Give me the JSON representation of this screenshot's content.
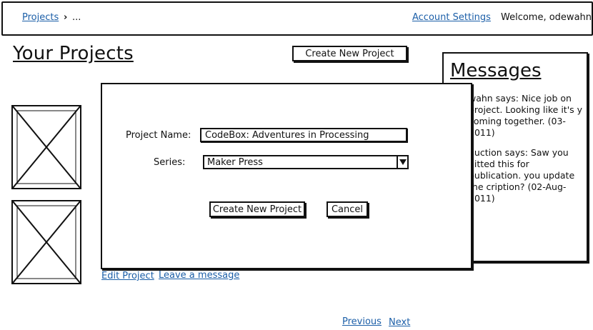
{
  "header": {
    "breadcrumb_root": "Projects",
    "breadcrumb_chevron": "›",
    "breadcrumb_current": "...",
    "account_settings": "Account Settings",
    "welcome": "Welcome, odewahn"
  },
  "main": {
    "title": "Your Projects",
    "create_button": "Create New Project",
    "edit_project": "Edit Project",
    "leave_message": "Leave a message",
    "pagination": {
      "previous": "Previous",
      "next": "Next"
    }
  },
  "messages": {
    "title": "Messages",
    "items": [
      "wahn says: Nice job on project.  Looking like it's y coming together. (03-2011)",
      "duction says: Saw you nitted this for publication. you update the cription? (02-Aug-2011)"
    ]
  },
  "modal": {
    "name_label": "Project Name:",
    "name_value": "CodeBox: Adventures in Processing",
    "series_label": "Series:",
    "series_value": "Maker Press",
    "create_button": "Create New Project",
    "cancel_button": "Cancel"
  },
  "icons": {
    "dropdown": "dropdown-arrow-icon",
    "placeholder": "image-placeholder-icon"
  },
  "colors": {
    "link": "#1c5fa8",
    "ink": "#111111",
    "background": "#ffffff"
  }
}
